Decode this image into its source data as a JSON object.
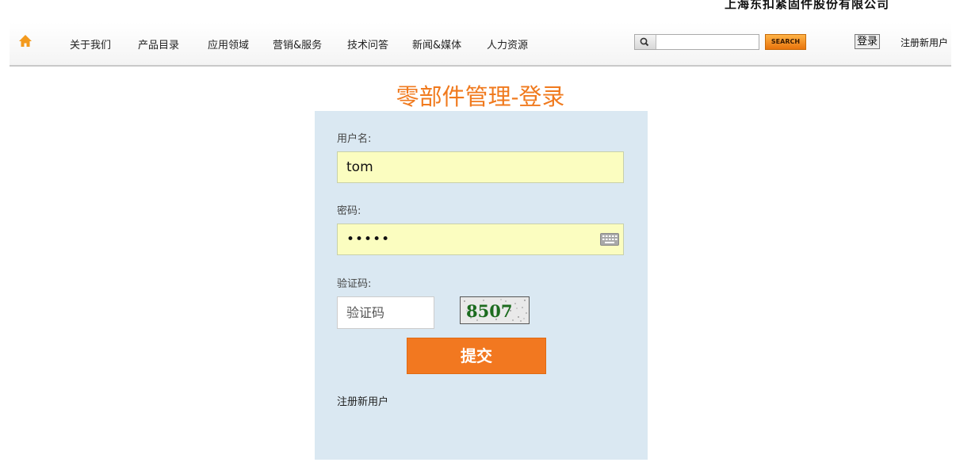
{
  "header": {
    "company": "上海东扣紧固件股份有限公司"
  },
  "nav": {
    "items": [
      "关于我们",
      "产品目录",
      "应用领域",
      "营销&服务",
      "技术问答",
      "新闻&媒体",
      "人力资源"
    ],
    "search_placeholder": "",
    "search_label": "SEARCH",
    "login": "登录",
    "register": "注册新用户"
  },
  "page": {
    "title": "零部件管理-登录"
  },
  "form": {
    "username_label": "用户名:",
    "username_value": "tom",
    "password_label": "密码:",
    "password_value": "•••••",
    "captcha_label": "验证码:",
    "captcha_placeholder": "验证码",
    "captcha_text": "8507",
    "submit": "提交",
    "register_link": "注册新用户"
  },
  "colors": {
    "accent": "#f27820",
    "title": "#f07a1e",
    "panel": "#dae8f2",
    "field": "#fbfdc0"
  },
  "icons": {
    "home": "home-icon",
    "search": "magnifier-icon",
    "keyboard": "keyboard-icon"
  }
}
